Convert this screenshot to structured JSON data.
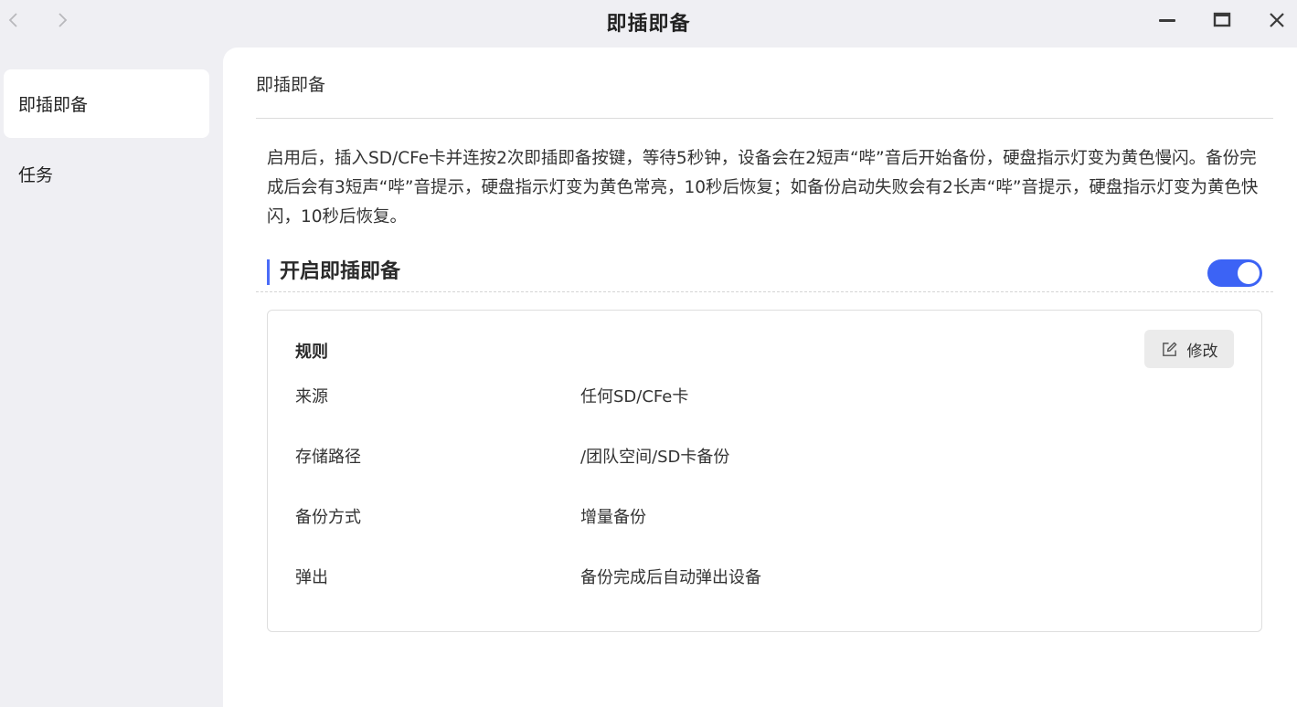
{
  "window": {
    "title": "即插即备",
    "icons": {
      "back": "chevron-left-icon",
      "forward": "chevron-right-icon",
      "minimize": "minimize-icon",
      "maximize": "maximize-icon",
      "close": "close-icon"
    }
  },
  "sidebar": {
    "items": [
      {
        "label": "即插即备",
        "active": true
      },
      {
        "label": "任务",
        "active": false
      }
    ]
  },
  "main": {
    "header": "即插即备",
    "description": "启用后，插入SD/CFe卡并连按2次即插即备按键，等待5秒钟，设备会在2短声“哔”音后开始备份，硬盘指示灯变为黄色慢闪。备份完成后会有3短声“哔”音提示，硬盘指示灯变为黄色常亮，10秒后恢复；如备份启动失败会有2长声“哔”音提示，硬盘指示灯变为黄色快闪，10秒后恢复。",
    "section_title": "开启即插即备",
    "toggle_on": true,
    "rule": {
      "title": "规则",
      "edit_label": "修改",
      "edit_icon": "edit-icon",
      "rows": [
        {
          "label": "来源",
          "value": "任何SD/CFe卡"
        },
        {
          "label": "存储路径",
          "value": "/团队空间/SD卡备份"
        },
        {
          "label": "备份方式",
          "value": "增量备份"
        },
        {
          "label": "弹出",
          "value": "备份完成后自动弹出设备"
        }
      ]
    }
  },
  "colors": {
    "accent": "#3c63f5",
    "sidebar_bg": "#efeff3",
    "content_bg": "#ffffff"
  }
}
